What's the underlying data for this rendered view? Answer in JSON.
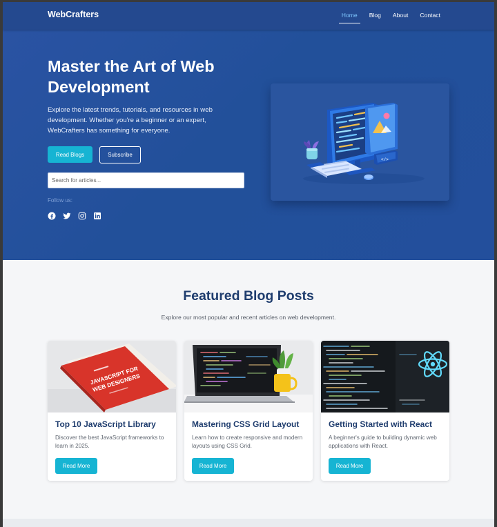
{
  "nav": {
    "brand": "WebCrafters",
    "links": [
      {
        "label": "Home",
        "active": true
      },
      {
        "label": "Blog",
        "active": false
      },
      {
        "label": "About",
        "active": false
      },
      {
        "label": "Contact",
        "active": false
      }
    ]
  },
  "hero": {
    "title": "Master the Art of Web Development",
    "text": "Explore the latest trends, tutorials, and resources in web development. Whether you're a beginner or an expert, WebCrafters has something for everyone.",
    "primary_button": "Read Blogs",
    "secondary_button": "Subscribe",
    "search_placeholder": "Search for articles...",
    "follow_label": "Follow us:",
    "socials": [
      "facebook-icon",
      "twitter-icon",
      "instagram-icon",
      "linkedin-icon"
    ]
  },
  "featured": {
    "title": "Featured Blog Posts",
    "subtitle": "Explore our most popular and recent articles on web development.",
    "posts": [
      {
        "title": "Top 10 JavaScript Library",
        "text": "Discover the best JavaScript frameworks to learn in 2025.",
        "button": "Read More",
        "image_lettering": "JAVASCRIPT FOR WEB DESIGNERS"
      },
      {
        "title": "Mastering CSS Grid Layout",
        "text": "Learn how to create responsive and modern layouts using CSS Grid.",
        "button": "Read More"
      },
      {
        "title": "Getting Started with React",
        "text": "A beginner's guide to building dynamic web applications with React.",
        "button": "Read More"
      }
    ]
  },
  "colors": {
    "nav_bg": "#24498f",
    "hero_bg": "#24509b",
    "accent": "#16b4d3",
    "heading": "#1f3d6e"
  }
}
